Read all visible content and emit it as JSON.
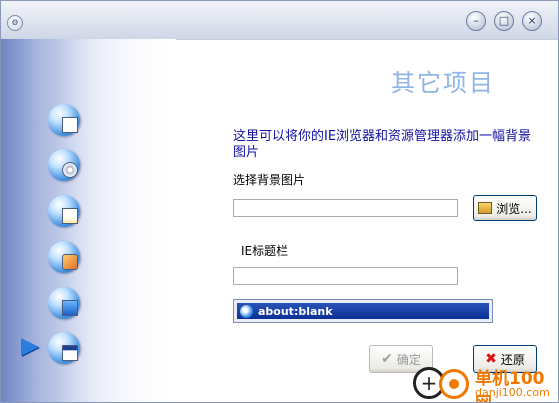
{
  "titlebar": {
    "minimize_symbol": "–",
    "maximize_symbol": "□",
    "close_symbol": "×"
  },
  "nav": {
    "icons": [
      "folder-icon",
      "disk-icon",
      "document-icon",
      "tools-icon",
      "monitor-icon",
      "window-icon"
    ],
    "selected_index": 5
  },
  "main": {
    "heading": "其它项目",
    "description": "这里可以将你的IE浏览器和资源管理器添加一幅背景图片",
    "bg_label": "选择背景图片",
    "bg_input_value": "",
    "browse_label": "浏览...",
    "ie_title_label": "IE标题栏",
    "ie_title_input_value": "",
    "preview_text": "about:blank",
    "ok_label": "确定",
    "restore_label": "还原"
  },
  "watermark": {
    "name": "单机100网",
    "url": "danji100.com"
  },
  "colors": {
    "heading": "#8fb4e6",
    "description": "#1010a0",
    "preview_bar": "#0a2f95"
  }
}
